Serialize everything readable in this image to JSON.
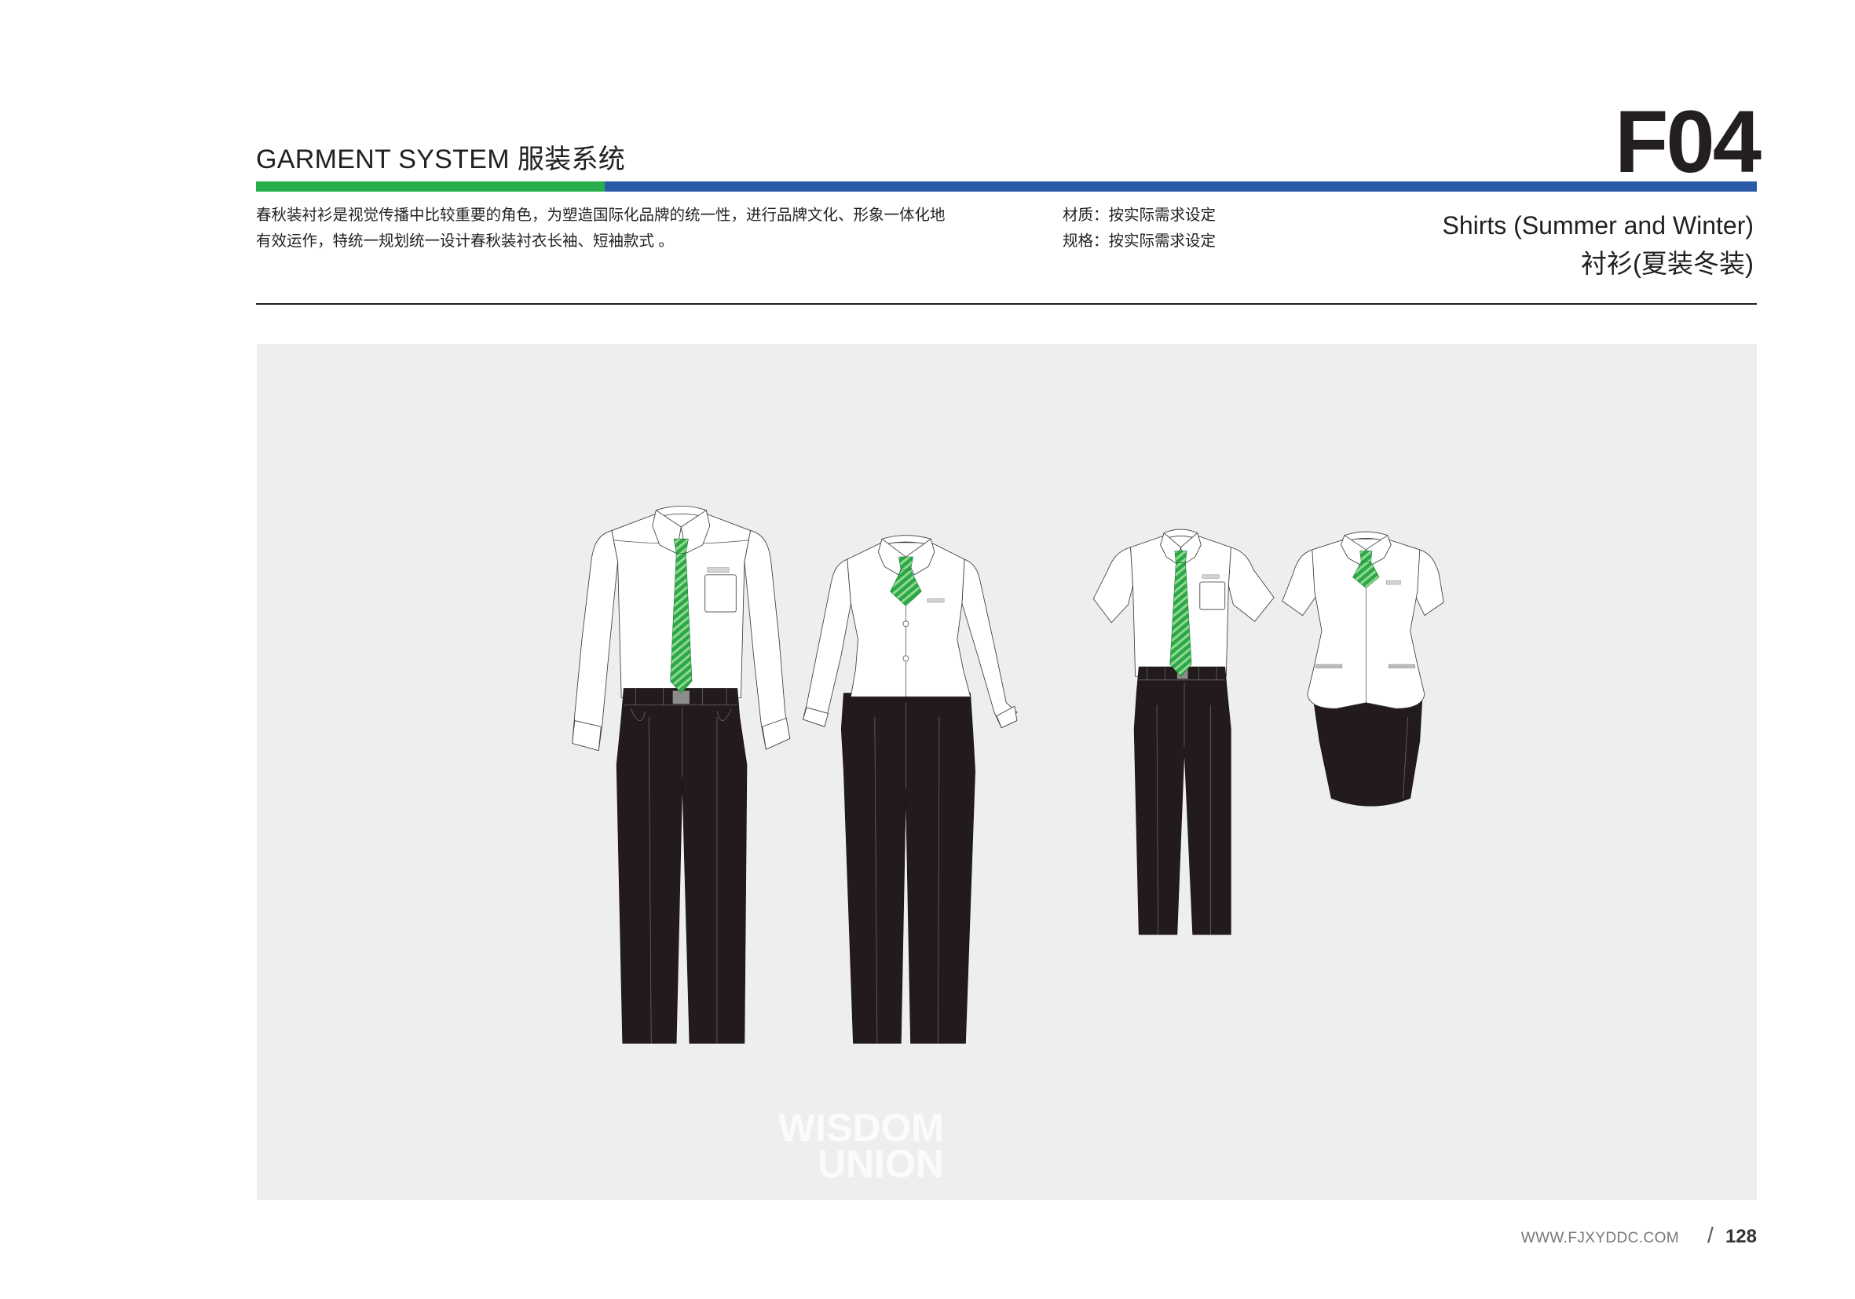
{
  "header": {
    "title_en": "GARMENT SYSTEM",
    "title_cn": "服装系统",
    "section_code": "F04"
  },
  "intro": {
    "line1": "春秋装衬衫是视觉传播中比较重要的角色，为塑造国际化品牌的统一性，进行品牌文化、形象一体化地",
    "line2": "有效运作，特统一规划统一设计春秋装衬衣长袖、短袖款式 。"
  },
  "specs": {
    "material": "材质：按实际需求设定",
    "size": "规格：按实际需求设定"
  },
  "page_title": {
    "en": "Shirts (Summer and Winter)",
    "cn": "衬衫(夏装冬装)"
  },
  "watermark": {
    "line1": "WISDOM",
    "line2": "UNION"
  },
  "footer": {
    "website": "WWW.FJXYDDC.COM",
    "separator": "/",
    "page_number": "128"
  },
  "colors": {
    "accent_green": "#27ae4a",
    "accent_blue": "#2b5ba8",
    "panel": "#edeeed",
    "shirt": "#ffffff",
    "trousers": "#231b1b",
    "tie": "#2aa84a",
    "tie_stripe": "#93d98f",
    "text": "#231f20"
  }
}
